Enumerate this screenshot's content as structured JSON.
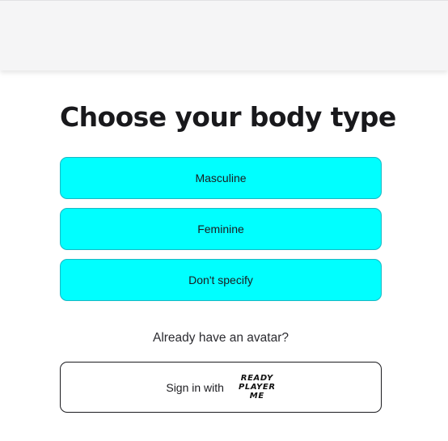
{
  "page": {
    "title": "Choose your body type"
  },
  "body_type_options": [
    {
      "label": "Masculine"
    },
    {
      "label": "Feminine"
    },
    {
      "label": "Don't specify"
    }
  ],
  "account": {
    "prompt": "Already have an avatar?",
    "signin_label": "Sign in with",
    "logo_lines": [
      "READY",
      "PLAYER",
      "ME"
    ]
  },
  "colors": {
    "option_background": "#00ffff",
    "option_border": "#19b8c4",
    "text": "#1b1b1f",
    "top_bar": "#f5f5f6"
  }
}
